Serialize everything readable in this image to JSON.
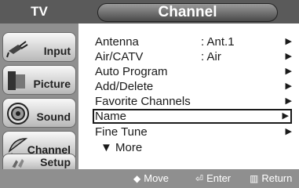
{
  "sidebar": {
    "header": "TV",
    "items": [
      {
        "label": "Input",
        "icon": "input-plug-icon"
      },
      {
        "label": "Picture",
        "icon": "picture-icon"
      },
      {
        "label": "Sound",
        "icon": "speaker-icon"
      },
      {
        "label": "Channel",
        "icon": "satellite-dish-icon"
      },
      {
        "label": "Setup",
        "icon": "setup-icon"
      }
    ]
  },
  "title": "Channel",
  "menu": {
    "items": [
      {
        "label": "Antenna",
        "value": ": Ant.1",
        "arrow": "▶"
      },
      {
        "label": "Air/CATV",
        "value": ": Air",
        "arrow": "▶"
      },
      {
        "label": "Auto Program",
        "value": "",
        "arrow": "▶"
      },
      {
        "label": "Add/Delete",
        "value": "",
        "arrow": "▶"
      },
      {
        "label": "Favorite Channels",
        "value": "",
        "arrow": "▶"
      },
      {
        "label": "Name",
        "value": "",
        "arrow": "▶",
        "selected": true
      },
      {
        "label": "Fine Tune",
        "value": "",
        "arrow": "▶"
      },
      {
        "label": "▼ More",
        "value": "",
        "arrow": ""
      }
    ]
  },
  "footer": {
    "move_icon": "◆",
    "move": "Move",
    "enter_icon": "⏎",
    "enter": "Enter",
    "return_icon": "▥",
    "return": "Return"
  }
}
